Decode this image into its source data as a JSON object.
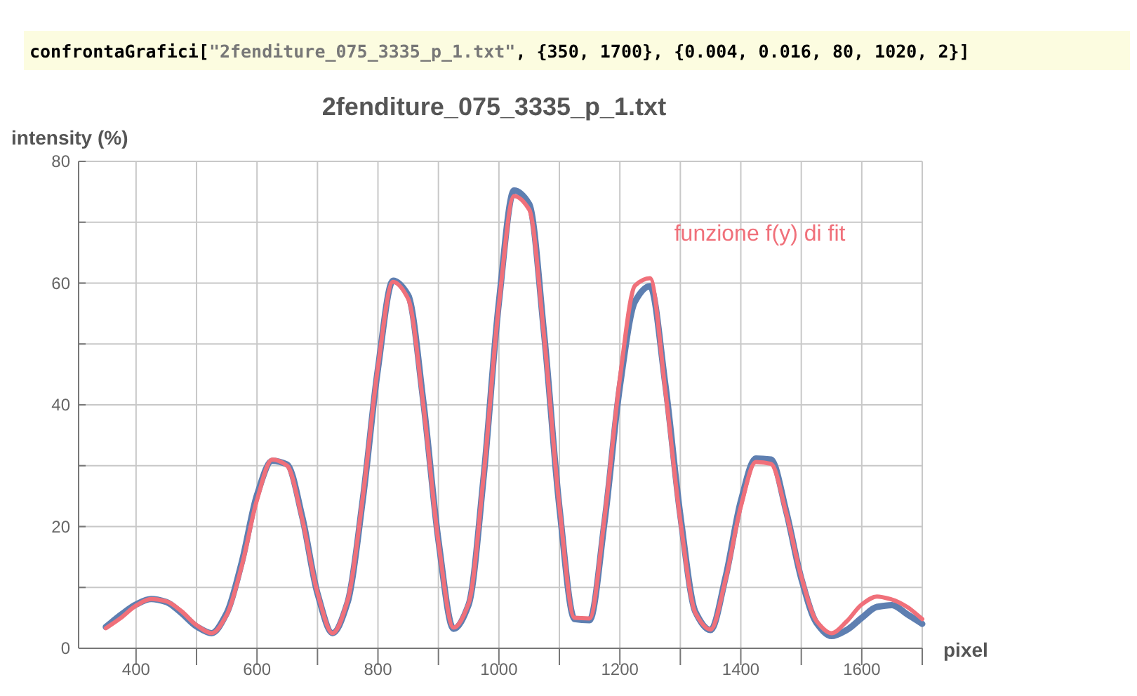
{
  "input_cell": {
    "parts": [
      {
        "kind": "plain",
        "text": "confrontaGrafici["
      },
      {
        "kind": "string",
        "text": "\"2fenditure_075_3335_p_1.txt\""
      },
      {
        "kind": "plain",
        "text": ", {350, 1700}, {0.004, 0.016, 80, 1020, 2}]"
      }
    ]
  },
  "chart": {
    "chart_data": {
      "type": "line",
      "title": "2fenditure_075_3335_p_1.txt",
      "xlabel": "pixel",
      "ylabel": "intensity (%)",
      "x": [
        350,
        375,
        400,
        425,
        450,
        475,
        500,
        525,
        550,
        575,
        600,
        625,
        650,
        675,
        700,
        725,
        750,
        775,
        800,
        825,
        850,
        875,
        900,
        925,
        950,
        975,
        1000,
        1025,
        1050,
        1075,
        1100,
        1125,
        1150,
        1175,
        1200,
        1225,
        1250,
        1275,
        1300,
        1325,
        1350,
        1375,
        1400,
        1425,
        1450,
        1475,
        1500,
        1525,
        1550,
        1575,
        1600,
        1625,
        1650,
        1675,
        1700
      ],
      "series": [
        {
          "color": "#5e7fb1",
          "values": [
            3.5,
            5.5,
            7.2,
            8.1,
            7.6,
            5.8,
            3.6,
            2.5,
            5.8,
            14.2,
            25.2,
            30.8,
            30.2,
            21.5,
            9.0,
            2.5,
            7.6,
            24.5,
            46.0,
            60.4,
            58.0,
            40.5,
            17.8,
            3.2,
            7.2,
            28.5,
            56.8,
            75.2,
            73.0,
            51.5,
            23.2,
            4.8,
            4.6,
            21.0,
            43.0,
            57.0,
            59.5,
            43.5,
            21.8,
            6.0,
            3.0,
            11.8,
            24.2,
            31.2,
            31.0,
            22.5,
            11.5,
            4.2,
            2.0,
            3.0,
            5.0,
            6.8,
            7.1,
            5.6,
            4.0
          ]
        },
        {
          "name": "funzione f(y) di fit",
          "color": "#f0707a",
          "values": [
            3.3,
            5.0,
            7.0,
            8.1,
            7.7,
            6.1,
            3.8,
            2.5,
            5.5,
            13.6,
            24.4,
            31.0,
            30.0,
            21.1,
            9.1,
            2.5,
            7.9,
            24.9,
            46.3,
            60.2,
            57.4,
            39.9,
            17.5,
            3.4,
            7.4,
            28.7,
            56.4,
            74.3,
            72.1,
            51.0,
            23.4,
            5.0,
            4.9,
            21.7,
            44.3,
            59.6,
            60.8,
            42.5,
            20.9,
            5.8,
            3.1,
            11.4,
            23.3,
            30.6,
            30.3,
            22.2,
            11.8,
            4.5,
            2.5,
            4.4,
            7.2,
            8.5,
            8.0,
            6.8,
            4.8
          ]
        }
      ],
      "xlim": [
        305,
        1700
      ],
      "ylim": [
        0,
        80
      ],
      "xticks": [
        400,
        600,
        800,
        1000,
        1200,
        1400,
        1600
      ],
      "yticks": [
        0,
        20,
        40,
        60,
        80
      ],
      "grid": true
    }
  }
}
